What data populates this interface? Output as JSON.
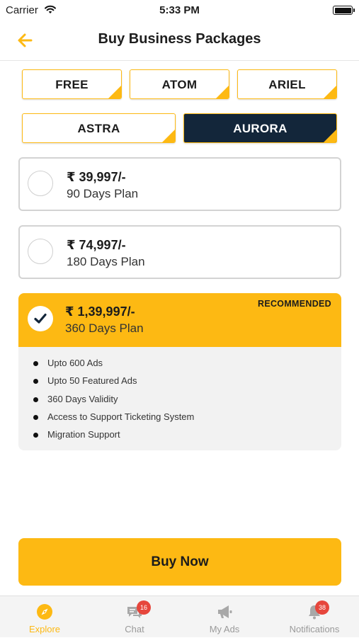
{
  "status_bar": {
    "carrier": "Carrier",
    "time": "5:33 PM"
  },
  "header": {
    "title": "Buy Business Packages"
  },
  "packages": [
    {
      "label": "FREE",
      "active": false
    },
    {
      "label": "ATOM",
      "active": false
    },
    {
      "label": "ARIEL",
      "active": false
    },
    {
      "label": "ASTRA",
      "active": false
    },
    {
      "label": "AURORA",
      "active": true
    }
  ],
  "plans": [
    {
      "price": "₹ 39,997/-",
      "duration": "90 Days Plan",
      "selected": false
    },
    {
      "price": "₹ 74,997/-",
      "duration": "180 Days Plan",
      "selected": false
    },
    {
      "price": "₹ 1,39,997/-",
      "duration": "360 Days Plan",
      "selected": true,
      "badge": "RECOMMENDED"
    }
  ],
  "features": [
    "Upto 600 Ads",
    "Upto 50 Featured Ads",
    "360 Days Validity",
    "Access to Support Ticketing System",
    "Migration Support"
  ],
  "buy_button": {
    "label": "Buy Now"
  },
  "bottom_nav": [
    {
      "label": "Explore",
      "icon": "compass-icon",
      "active": true
    },
    {
      "label": "Chat",
      "icon": "chat-icon",
      "badge": "16"
    },
    {
      "label": "My Ads",
      "icon": "megaphone-icon"
    },
    {
      "label": "Notifications",
      "icon": "bell-icon",
      "badge": "38"
    }
  ],
  "colors": {
    "accent": "#fdb913",
    "active_tab": "#13263a",
    "badge": "#e6463c"
  }
}
